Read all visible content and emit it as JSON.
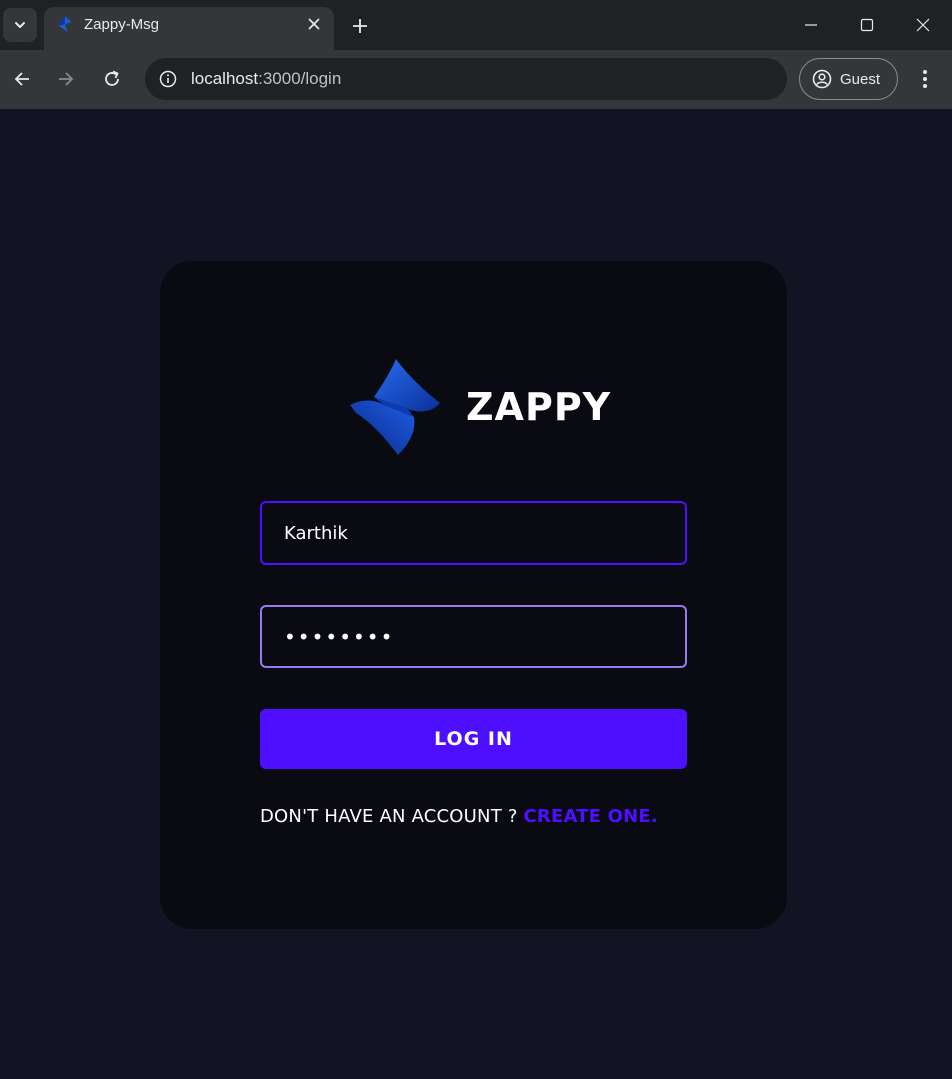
{
  "browser": {
    "tab_title": "Zappy-Msg",
    "url_host": "localhost",
    "url_path": ":3000/login",
    "profile_label": "Guest"
  },
  "login": {
    "brand_name": "ZAPPY",
    "username_value": "Karthik",
    "password_value": "••••••••",
    "login_button": "LOG IN",
    "signup_prompt": "DON'T HAVE AN ACCOUNT ? ",
    "signup_link": "CREATE ONE."
  },
  "colors": {
    "page_bg": "#131324",
    "card_bg": "#0a0a12",
    "accent": "#4e0eff",
    "focus_border": "#997af0"
  }
}
